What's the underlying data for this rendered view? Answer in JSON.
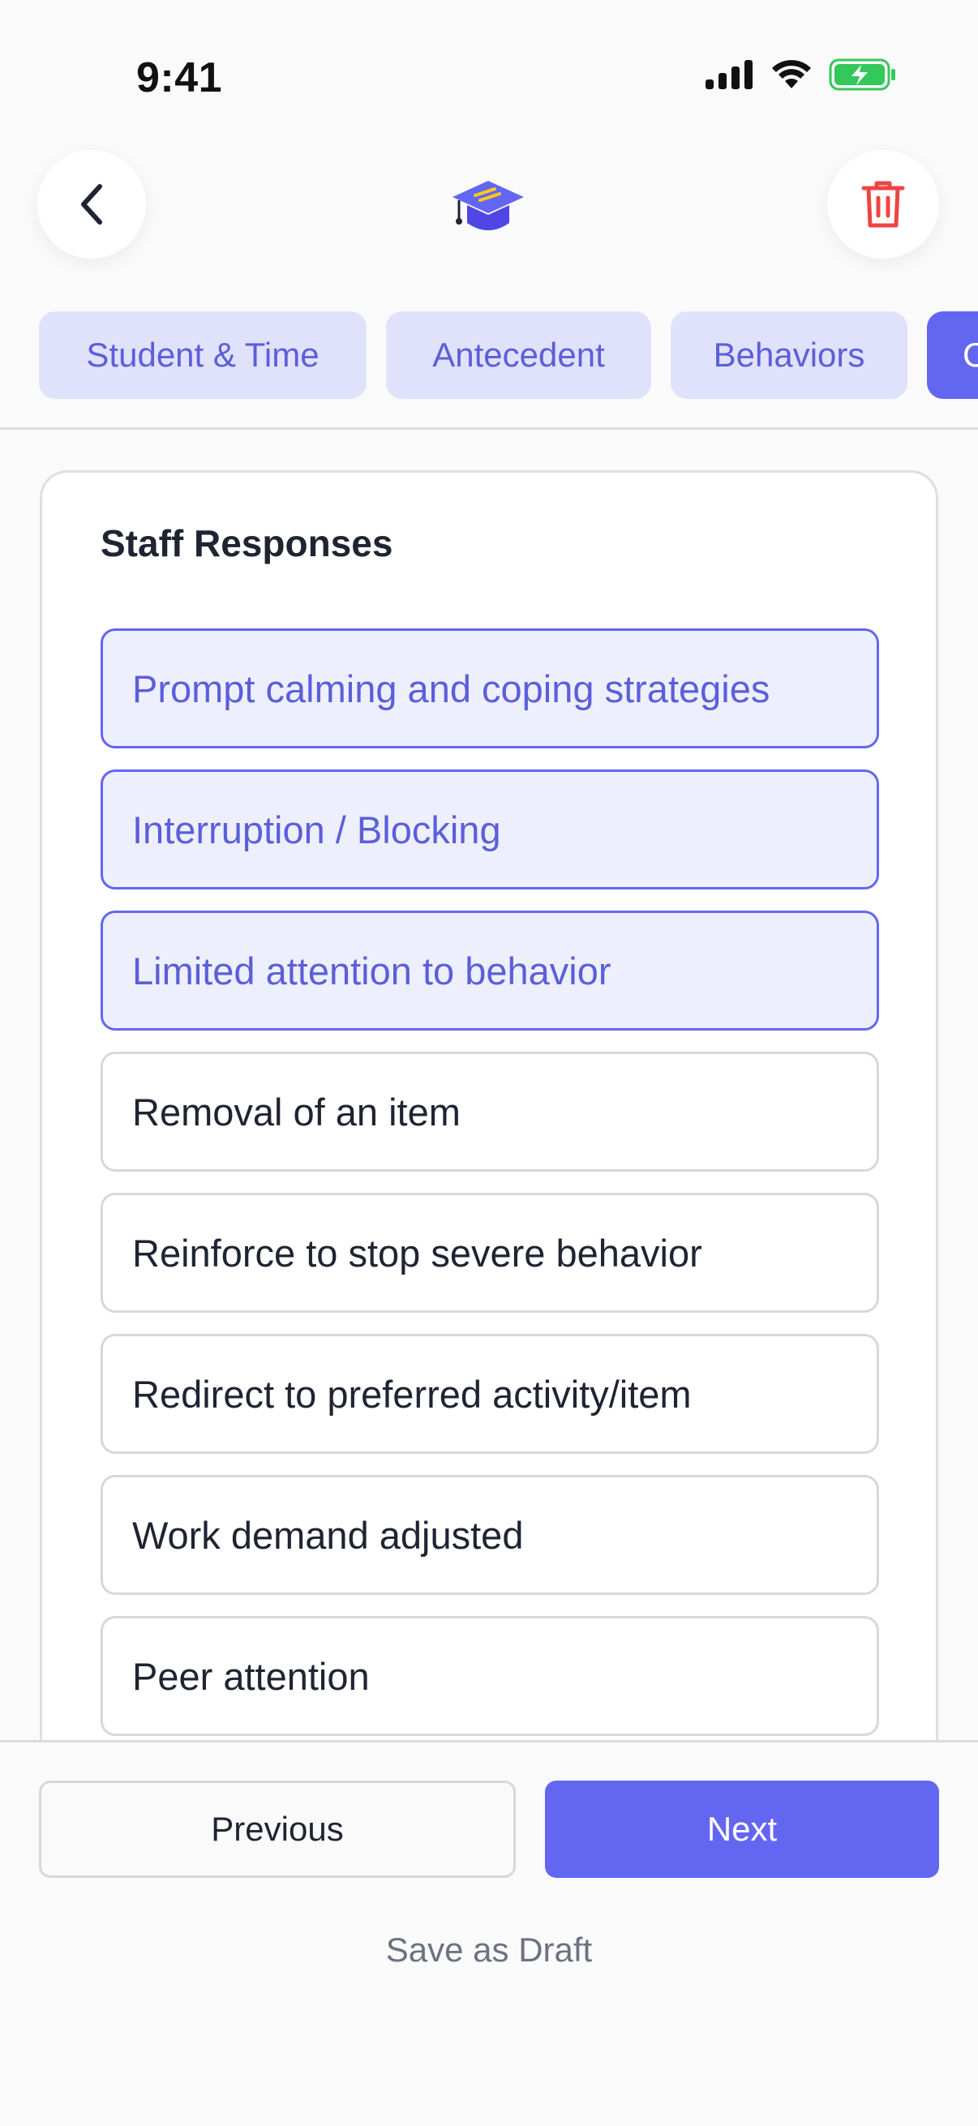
{
  "status_bar": {
    "time": "9:41"
  },
  "header": {
    "back_icon": "chevron-left-icon",
    "logo_icon": "graduation-cap-icon",
    "delete_icon": "trash-icon"
  },
  "tabs": [
    {
      "label": "Student & Time",
      "active": false
    },
    {
      "label": "Antecedent",
      "active": false
    },
    {
      "label": "Behaviors",
      "active": false
    },
    {
      "label": "C",
      "active": true
    }
  ],
  "section": {
    "title": "Staff Responses",
    "options": [
      {
        "label": "Prompt calming and coping strategies",
        "selected": true
      },
      {
        "label": "Interruption / Blocking",
        "selected": true
      },
      {
        "label": "Limited attention to behavior",
        "selected": true
      },
      {
        "label": "Removal of an item",
        "selected": false
      },
      {
        "label": "Reinforce to stop severe behavior",
        "selected": false
      },
      {
        "label": "Redirect to preferred activity/item",
        "selected": false
      },
      {
        "label": "Work demand adjusted",
        "selected": false
      },
      {
        "label": "Peer attention",
        "selected": false
      }
    ]
  },
  "footer": {
    "previous_label": "Previous",
    "next_label": "Next",
    "save_draft_label": "Save as Draft"
  },
  "colors": {
    "accent": "#6366f1",
    "selected_bg": "#eeeffd",
    "tab_bg": "#e0e1fa",
    "danger": "#ef4444",
    "battery_green": "#34c759"
  }
}
